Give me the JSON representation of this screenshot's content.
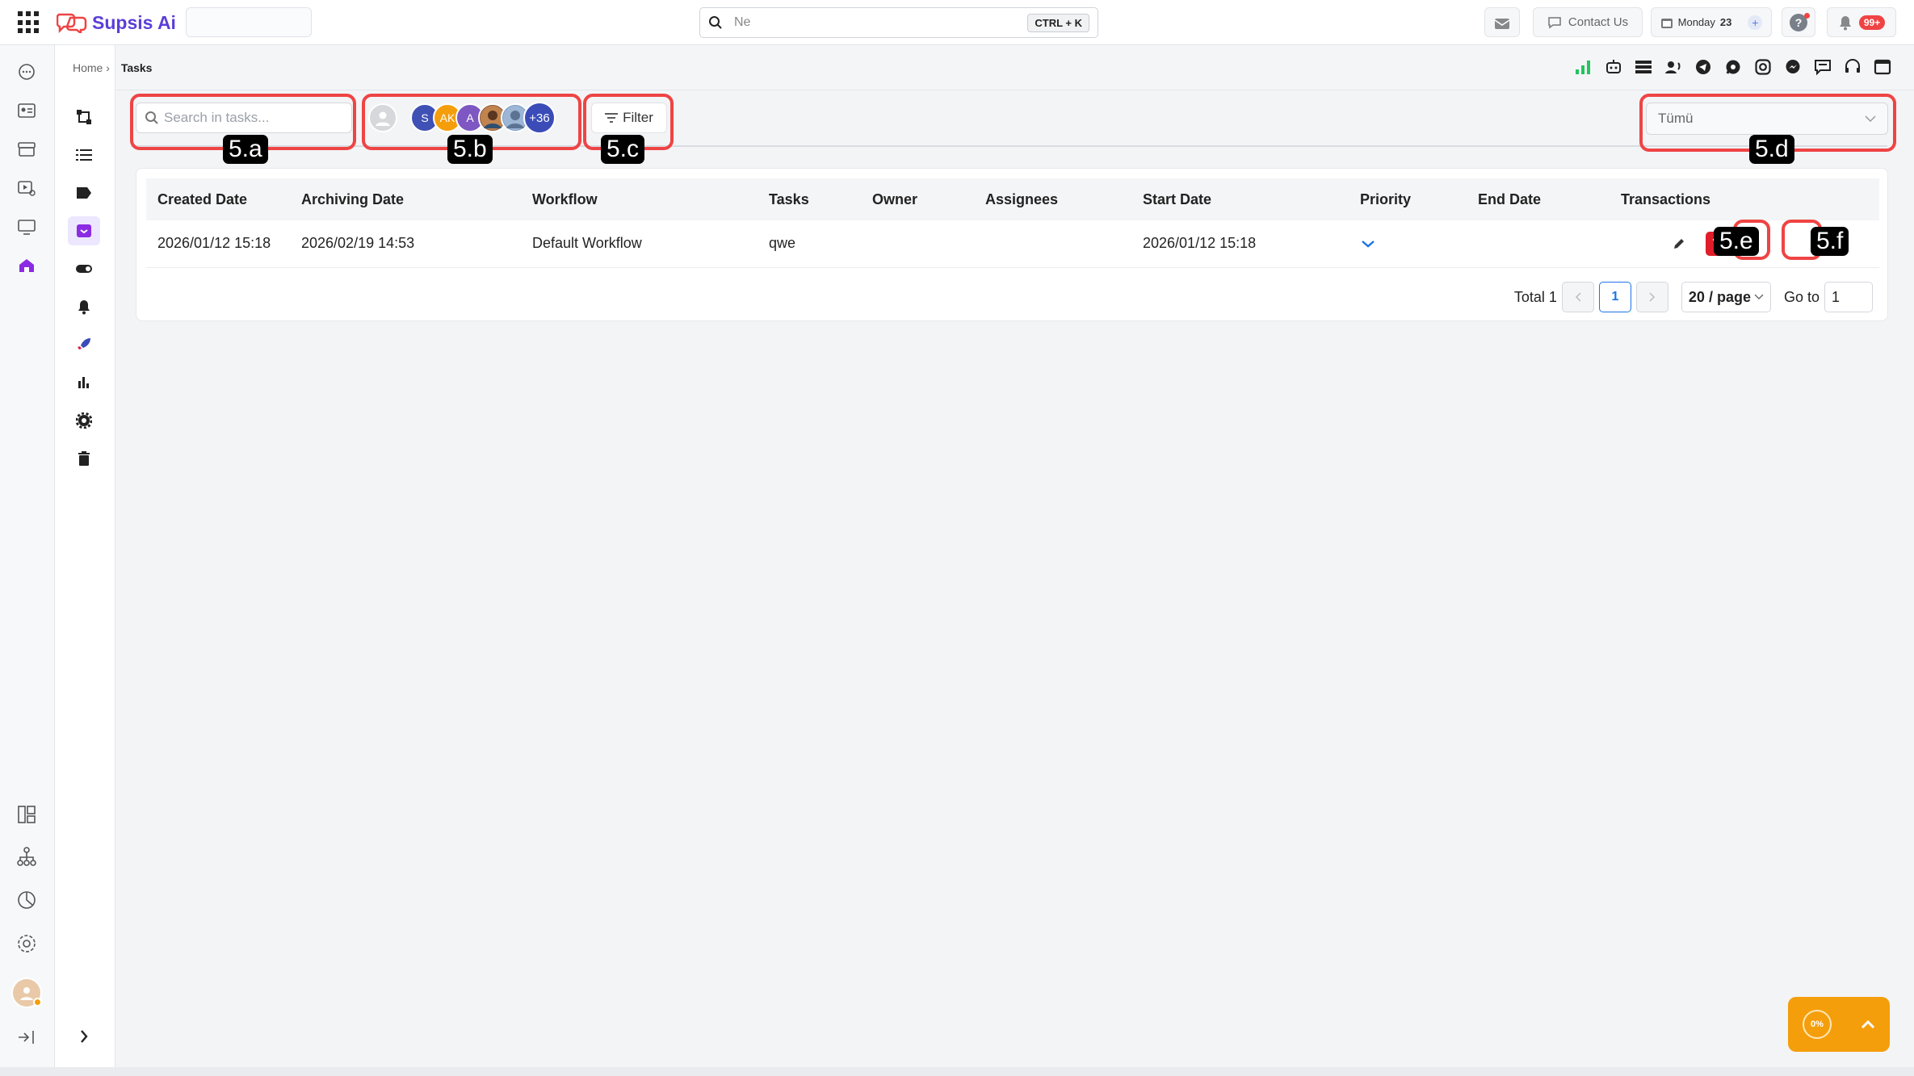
{
  "app": {
    "name": "Supsis Ai",
    "brand_color": "#5a3fd8"
  },
  "topbar": {
    "search_placeholder": "Ne",
    "search_shortcut": "CTRL + K",
    "contact_label": "Contact Us",
    "date_day": "Monday",
    "date_num": "23",
    "notification_count": "99+"
  },
  "breadcrumb": {
    "home": "Home",
    "separator": "›",
    "current": "Tasks"
  },
  "toolbar": {
    "search_placeholder": "Search in tasks...",
    "assignees": [
      {
        "initials": "",
        "color": "#d6d8dc"
      },
      {
        "initials": "S",
        "color": "#3f51b5"
      },
      {
        "initials": "AK",
        "color": "#f59e0b"
      },
      {
        "initials": "A",
        "color": "#7e57c2"
      },
      {
        "initials": "",
        "color": "#8d5a3b"
      },
      {
        "initials": "",
        "color": "#7a9cc6"
      },
      {
        "initials": "+36",
        "color": "#3b4cb8"
      }
    ],
    "filter_label": "Filter",
    "status_select_value": "Tümü"
  },
  "callouts": {
    "a": "5.a",
    "b": "5.b",
    "c": "5.c",
    "d": "5.d",
    "e": "5.e",
    "f": "5.f"
  },
  "table": {
    "columns": [
      "Created Date",
      "Archiving Date",
      "Workflow",
      "Tasks",
      "Owner",
      "Assignees",
      "Start Date",
      "Priority",
      "End Date",
      "Transactions"
    ],
    "rows": [
      {
        "created": "2026/01/12 15:18",
        "archived": "2026/02/19 14:53",
        "workflow": "Default Workflow",
        "task": "qwe",
        "owner": "",
        "assignees": "",
        "start": "2026/01/12 15:18",
        "priority_icon": "chevron-down-icon",
        "end": ""
      }
    ]
  },
  "pagination": {
    "total_label": "Total 1",
    "current_page": "1",
    "page_size": "20 / page",
    "goto_label": "Go to",
    "goto_value": "1"
  },
  "floating": {
    "progress": "0%"
  }
}
